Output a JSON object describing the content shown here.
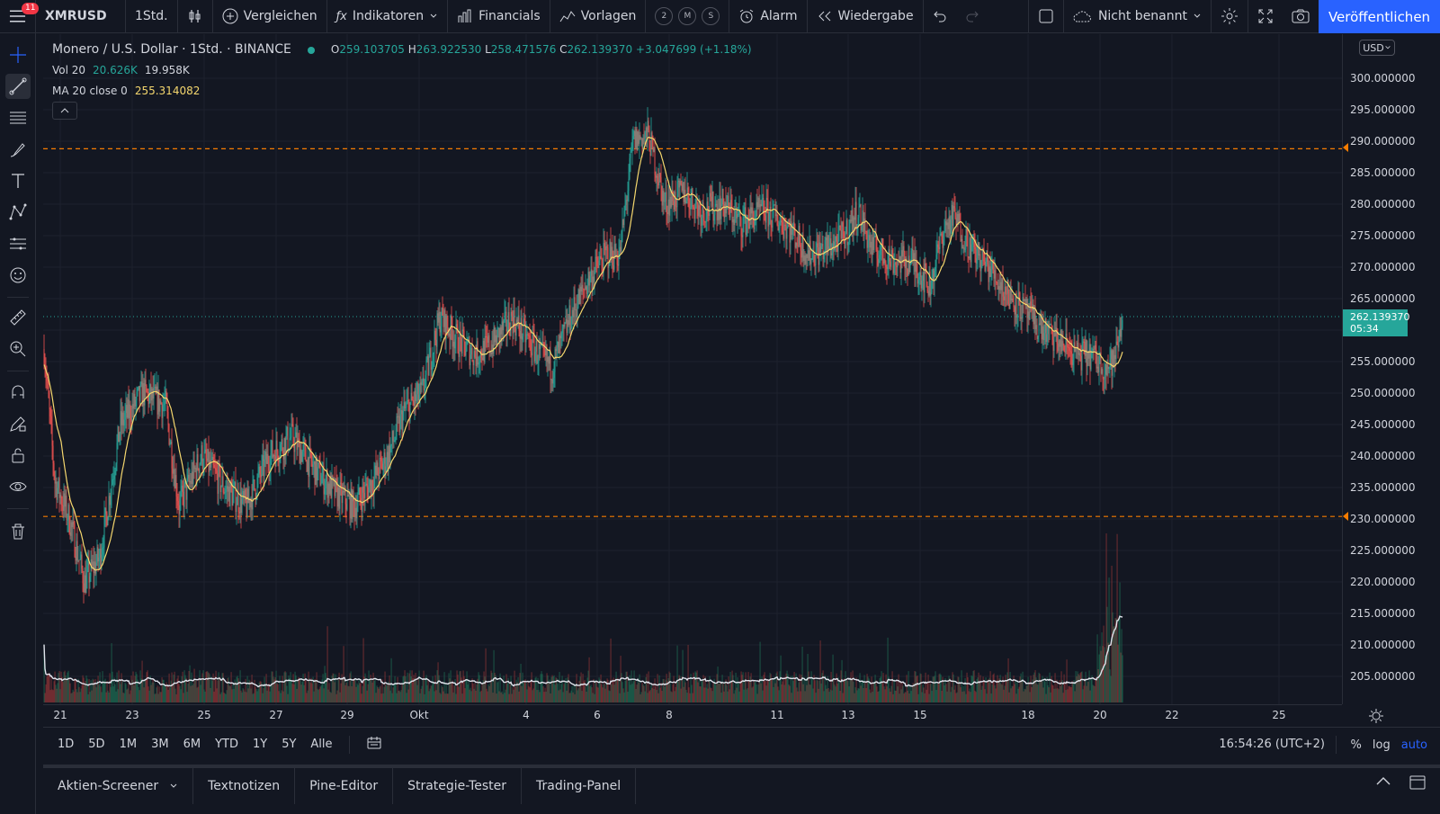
{
  "toolbar": {
    "menu_badge": "11",
    "symbol": "XMRUSD",
    "interval": "1Std.",
    "compare": "Vergleichen",
    "indicators": "Indikatoren",
    "financials": "Financials",
    "templates": "Vorlagen",
    "layout_circles": [
      "2",
      "M",
      "S"
    ],
    "alert": "Alarm",
    "replay": "Wiedergabe",
    "layout_name": "Nicht benannt",
    "publish": "Veröffentlichen"
  },
  "legend": {
    "title": "Monero / U.S. Dollar · 1Std. · BINANCE",
    "ohlc": {
      "o_label": "O",
      "o": "259.103705",
      "h_label": "H",
      "h": "263.922530",
      "l_label": "L",
      "l": "258.471576",
      "c_label": "C",
      "c": "262.139370",
      "change": "+3.047699 (+1.18%)"
    },
    "volume": {
      "label": "Vol 20",
      "value1": "20.626K",
      "value2": "19.958K"
    },
    "ma": {
      "label": "MA 20 close 0",
      "value": "255.314082"
    }
  },
  "price_axis": {
    "currency": "USD",
    "current_price": "262.139370",
    "countdown": "05:34",
    "ticks": [
      "300.000000",
      "295.000000",
      "290.000000",
      "285.000000",
      "280.000000",
      "275.000000",
      "270.000000",
      "265.000000",
      "255.000000",
      "250.000000",
      "245.000000",
      "240.000000",
      "235.000000",
      "230.000000",
      "225.000000",
      "220.000000",
      "215.000000",
      "210.000000",
      "205.000000"
    ]
  },
  "time_axis": {
    "ticks": [
      "21",
      "23",
      "25",
      "27",
      "29",
      "Okt",
      "4",
      "6",
      "8",
      "11",
      "13",
      "15",
      "18",
      "20",
      "22",
      "25"
    ]
  },
  "range_bar": {
    "ranges": [
      "1D",
      "5D",
      "1M",
      "3M",
      "6M",
      "YTD",
      "1Y",
      "5Y",
      "Alle"
    ],
    "clock": "16:54:26 (UTC+2)",
    "percent": "%",
    "log": "log",
    "auto": "auto"
  },
  "bottom_tabs": [
    "Aktien-Screener",
    "Textnotizen",
    "Pine-Editor",
    "Strategie-Tester",
    "Trading-Panel"
  ],
  "colors": {
    "up": "#26a69a",
    "down": "#ef5350",
    "ma": "#f5d76e",
    "hline": "#f57c00",
    "accent": "#2962ff"
  },
  "chart_data": {
    "type": "candlestick",
    "y_range": [
      200,
      302
    ],
    "horizontal_levels": [
      288.8,
      230.4
    ],
    "last_price": 262.13937,
    "ma_period": 20,
    "close_path_keypoints": [
      [
        0,
        257
      ],
      [
        12,
        236
      ],
      [
        28,
        230
      ],
      [
        45,
        220
      ],
      [
        62,
        224
      ],
      [
        85,
        245
      ],
      [
        110,
        250
      ],
      [
        135,
        248
      ],
      [
        150,
        232
      ],
      [
        175,
        240
      ],
      [
        200,
        235
      ],
      [
        225,
        232
      ],
      [
        250,
        240
      ],
      [
        275,
        243
      ],
      [
        300,
        238
      ],
      [
        325,
        234
      ],
      [
        345,
        232
      ],
      [
        365,
        236
      ],
      [
        382,
        240
      ],
      [
        400,
        247
      ],
      [
        420,
        250
      ],
      [
        440,
        262
      ],
      [
        462,
        258
      ],
      [
        480,
        256
      ],
      [
        500,
        258
      ],
      [
        520,
        262
      ],
      [
        545,
        257
      ],
      [
        565,
        254
      ],
      [
        585,
        262
      ],
      [
        605,
        268
      ],
      [
        625,
        272
      ],
      [
        640,
        272
      ],
      [
        655,
        290
      ],
      [
        672,
        291
      ],
      [
        690,
        280
      ],
      [
        712,
        282
      ],
      [
        730,
        279
      ],
      [
        755,
        280
      ],
      [
        775,
        277
      ],
      [
        800,
        279
      ],
      [
        830,
        276
      ],
      [
        850,
        272
      ],
      [
        870,
        273
      ],
      [
        890,
        275
      ],
      [
        905,
        279
      ],
      [
        920,
        273
      ],
      [
        945,
        271
      ],
      [
        965,
        271
      ],
      [
        985,
        267
      ],
      [
        1000,
        276
      ],
      [
        1012,
        278
      ],
      [
        1030,
        273
      ],
      [
        1050,
        270
      ],
      [
        1070,
        266
      ],
      [
        1090,
        263
      ],
      [
        1110,
        260
      ],
      [
        1130,
        258
      ],
      [
        1150,
        256
      ],
      [
        1165,
        256
      ],
      [
        1180,
        254
      ],
      [
        1190,
        255
      ],
      [
        1199,
        262
      ]
    ],
    "volume_max": 20.626
  }
}
